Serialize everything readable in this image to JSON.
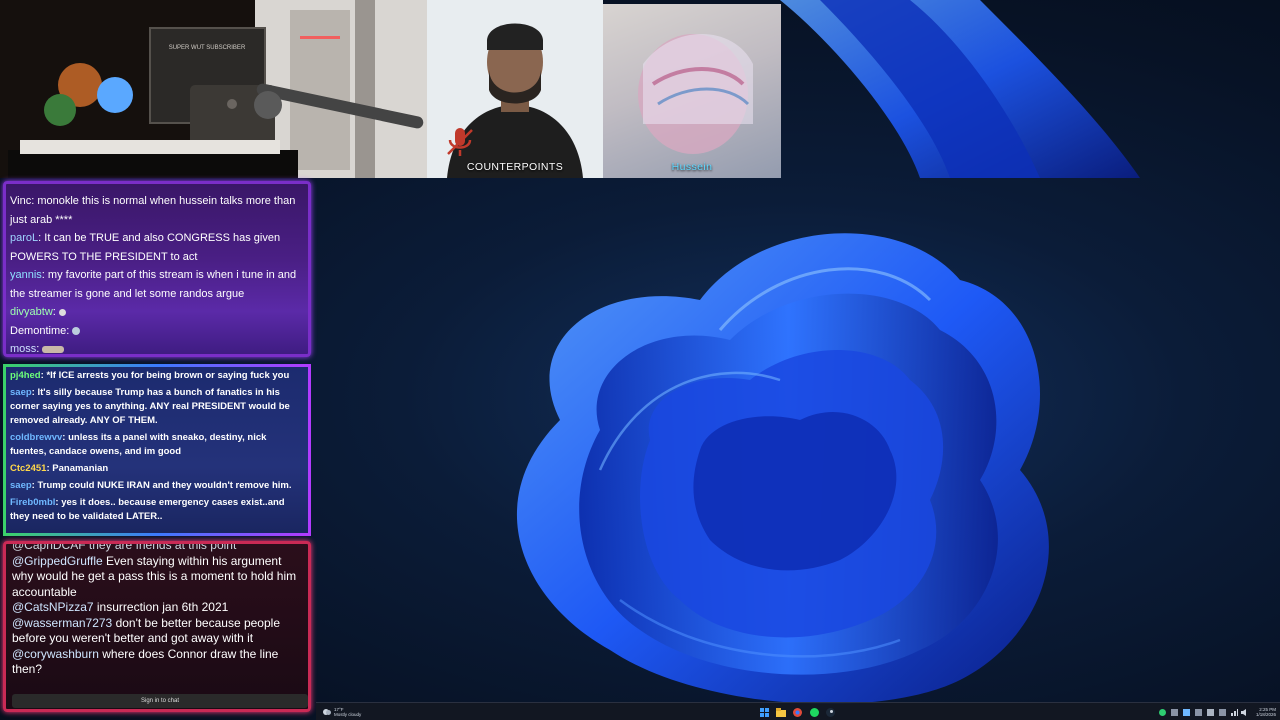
{
  "colors": {
    "accent": "#1f6bff",
    "chat1_border": "#7a2ec8",
    "chat3_border": "#c92a55"
  },
  "stream": {
    "room_cam": {
      "poster_text": "SUPER WUT SUBSCRIBER"
    },
    "guest_cam": {
      "label": "COUNTERPOINTS",
      "mic_icon": "mic-muted-icon"
    },
    "guest2_cam": {
      "label": "Hussein"
    }
  },
  "chat1": {
    "partial_top": "",
    "messages": [
      {
        "name": "Vinc",
        "name_color": "#ffffff",
        "text": "monokle this is normal when hussein talks more than just arab ****"
      },
      {
        "name": "paroL",
        "name_color": "#9fd4ff",
        "text": "It can be TRUE and also CONGRESS has given POWERS TO THE PRESIDENT to act"
      },
      {
        "name": "yannis",
        "name_color": "#8fe0ff",
        "text": "my favorite part of this stream is when i tune in and the streamer is gone and let some randos argue"
      },
      {
        "name": "divyabtw",
        "name_color": "#9effb0",
        "text": ""
      },
      {
        "name": "Demontime",
        "name_color": "#ffffff",
        "text": ""
      },
      {
        "name": "moss",
        "name_color": "#cfe0ff",
        "text": ""
      }
    ]
  },
  "chat2": {
    "messages": [
      {
        "name": "pj4hed",
        "name_color": "#6cff7a",
        "text": "*If ICE arrests you for being brown or saying fuck you"
      },
      {
        "name": "saep",
        "name_color": "#6fb8ff",
        "text": "It's silly because Trump has a bunch of fanatics in his corner saying yes to anything. ANY real PRESIDENT would be removed already. ANY OF THEM."
      },
      {
        "name": "coldbrewvv",
        "name_color": "#6fb8ff",
        "text": "unless its a panel with sneako, destiny, nick fuentes, candace owens, and im good"
      },
      {
        "name": "Ctc2451",
        "name_color": "#ffd84a",
        "text": "Panamanian"
      },
      {
        "name": "saep",
        "name_color": "#6fb8ff",
        "text": "Trump could NUKE IRAN and they wouldn't remove him."
      },
      {
        "name": "Fireb0mbl",
        "name_color": "#6fb8ff",
        "text": "yes it does.. because emergency cases exist..and they need to be validated LATER.."
      }
    ]
  },
  "chat3": {
    "partial_top": "@CapnDCAF they are friends at this point",
    "messages": [
      {
        "handle": "@GrippedGruffle",
        "text": "Even staying within his argument why would he get a pass this is a moment to hold him accountable"
      },
      {
        "handle": "@CatsNPizza7",
        "text": "insurrection jan 6th 2021"
      },
      {
        "handle": "@wasserman7273",
        "text": "don't be better because people before you weren't better and got away with it"
      },
      {
        "handle": "@corywashburn",
        "text": "where does Connor draw the line then?"
      }
    ],
    "signin_label": "Sign in to chat"
  },
  "taskbar": {
    "weather_temp": "17°F",
    "weather_desc": "Mostly cloudy",
    "icons": [
      "windows-start-icon",
      "file-explorer-icon",
      "chrome-icon",
      "spotify-icon",
      "steam-icon"
    ],
    "tray_icons": [
      "tray-green-icon",
      "tray-app-icon",
      "tray-app-icon",
      "tray-app-icon",
      "tray-app-icon",
      "tray-app-icon",
      "network-icon",
      "volume-icon"
    ],
    "time": "2:25 PM",
    "date": "1/18/2026"
  }
}
